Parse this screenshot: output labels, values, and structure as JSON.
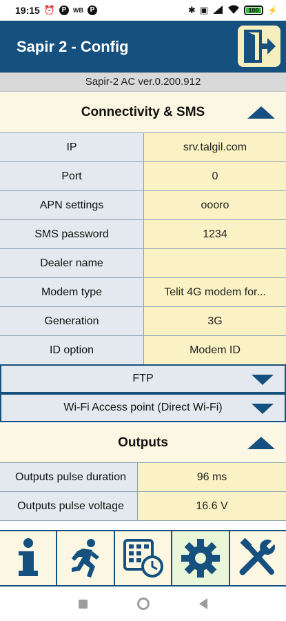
{
  "status_bar": {
    "time": "19:15",
    "battery_percent": "100"
  },
  "app_bar": {
    "title": "Sapir 2 - Config"
  },
  "version": "Sapir-2 AC ver.0.200.912",
  "connectivity": {
    "title": "Connectivity & SMS",
    "rows": [
      {
        "label": "IP",
        "value": "srv.talgil.com"
      },
      {
        "label": "Port",
        "value": "0"
      },
      {
        "label": "APN settings",
        "value": "oooro"
      },
      {
        "label": "SMS password",
        "value": "1234"
      },
      {
        "label": "Dealer name",
        "value": ""
      },
      {
        "label": "Modem type",
        "value": "Telit 4G modem for..."
      },
      {
        "label": "Generation",
        "value": "3G"
      },
      {
        "label": "ID option",
        "value": "Modem ID"
      }
    ]
  },
  "ftp": {
    "label": "FTP"
  },
  "wifi": {
    "label": "Wi-Fi Access point (Direct Wi-Fi)"
  },
  "outputs": {
    "title": "Outputs",
    "rows": [
      {
        "label": "Outputs pulse duration",
        "value": "96 ms"
      },
      {
        "label": "Outputs pulse voltage",
        "value": "16.6 V"
      }
    ]
  },
  "toolbar": {
    "items": [
      {
        "icon": "info-icon"
      },
      {
        "icon": "running-man-icon"
      },
      {
        "icon": "calendar-clock-icon"
      },
      {
        "icon": "gear-icon",
        "active": true
      },
      {
        "icon": "tools-icon"
      }
    ]
  },
  "colors": {
    "primary": "#16507f",
    "key_bg": "#e3e9ee",
    "value_bg": "#faf2c4",
    "header_bg": "#fbf7e3"
  }
}
